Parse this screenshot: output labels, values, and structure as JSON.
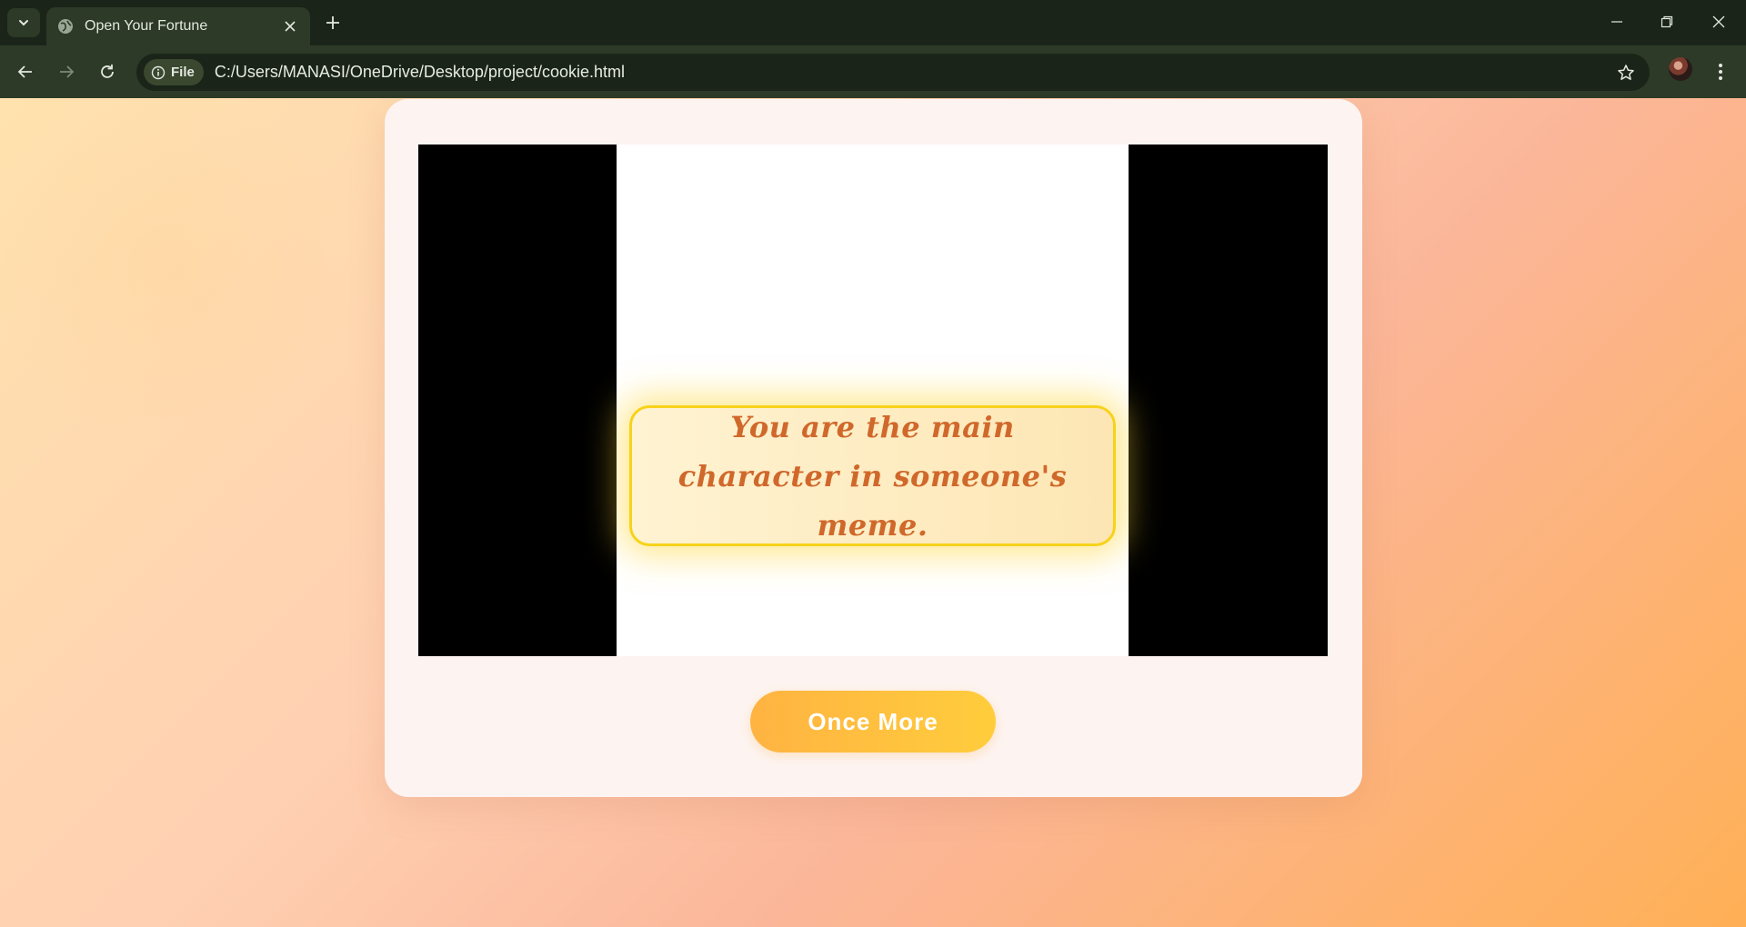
{
  "browser": {
    "tab": {
      "title": "Open Your Fortune",
      "icon": "globe-icon"
    },
    "address_bar": {
      "chip_label": "File",
      "url": "C:/Users/MANASI/OneDrive/Desktop/project/cookie.html"
    },
    "theme": {
      "frame": "#1b2418",
      "toolbar": "#2c3a27"
    }
  },
  "page": {
    "fortune": {
      "message": "You are the main character in someone's meme."
    },
    "button": {
      "label": "Once More"
    },
    "colors": {
      "card": "#fdf4f1",
      "fortune_text": "#d0682b",
      "fortune_border": "#f7d21a",
      "button_start": "#ffb342",
      "button_end": "#ffcd3c"
    }
  }
}
